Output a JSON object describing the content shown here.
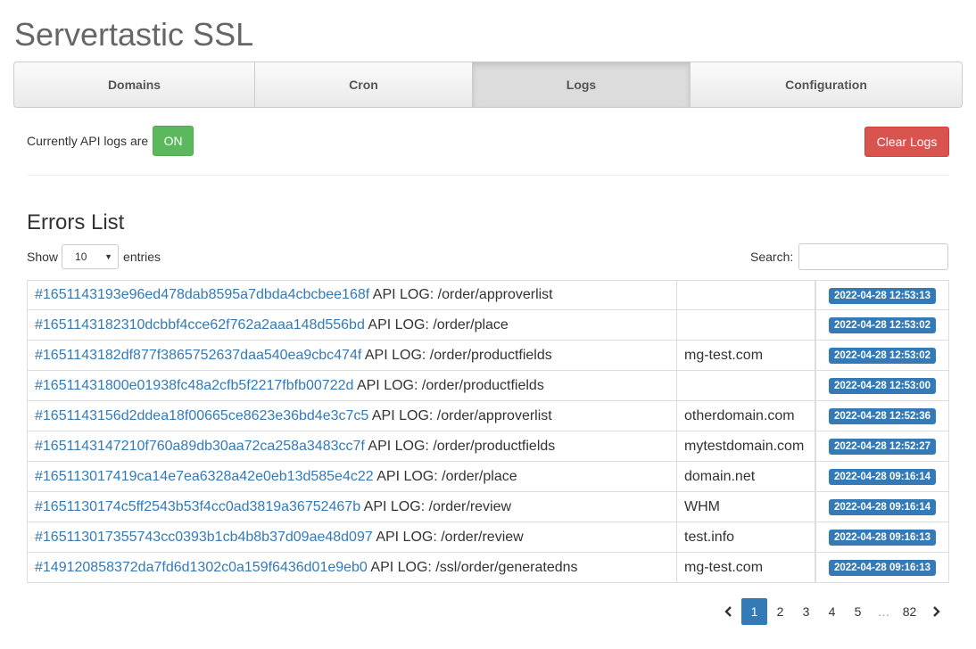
{
  "app": {
    "title": "Servertastic SSL"
  },
  "tabs": [
    {
      "label": "Domains",
      "active": false
    },
    {
      "label": "Cron",
      "active": false
    },
    {
      "label": "Logs",
      "active": true
    },
    {
      "label": "Configuration",
      "active": false
    }
  ],
  "api_logs": {
    "status_text": "Currently API logs are",
    "toggle_label": "ON",
    "toggle_color": "#5cb85c"
  },
  "clear_button": {
    "label": "Clear Logs",
    "color": "#d9534f"
  },
  "errors": {
    "title": "Errors List",
    "show_label": "Show",
    "entries_label": "entries",
    "page_size": "10",
    "search_label": "Search:",
    "search_value": "",
    "rows": [
      {
        "id": "#1651143193e96ed478dab8595a7dbda4cbcbee168f",
        "text": " API LOG: /order/approverlist",
        "domain": "",
        "date": "2022-04-28 12:53:13"
      },
      {
        "id": "#1651143182310dcbbf4cce62f762a2aaa148d556bd",
        "text": " API LOG: /order/place",
        "domain": "",
        "date": "2022-04-28 12:53:02"
      },
      {
        "id": "#1651143182df877f3865752637daa540ea9cbc474f",
        "text": " API LOG: /order/productfields",
        "domain": "mg-test.com",
        "date": "2022-04-28 12:53:02"
      },
      {
        "id": "#16511431800e01938fc48a2cfb5f2217fbfb00722d",
        "text": " API LOG: /order/productfields",
        "domain": "",
        "date": "2022-04-28 12:53:00"
      },
      {
        "id": "#1651143156d2ddea18f00665ce8623e36bd4e3c7c5",
        "text": " API LOG: /order/approverlist",
        "domain": "otherdomain.com",
        "date": "2022-04-28 12:52:36"
      },
      {
        "id": "#1651143147210f760a89db30aa72ca258a3483cc7f",
        "text": " API LOG: /order/productfields",
        "domain": "mytestdomain.com",
        "date": "2022-04-28 12:52:27"
      },
      {
        "id": "#165113017419ca14e7ea6328a42e0eb13d585e4c22",
        "text": " API LOG: /order/place",
        "domain": "domain.net",
        "date": "2022-04-28 09:16:14"
      },
      {
        "id": "#1651130174c5ff2543b53f4cc0ad3819a36752467b",
        "text": " API LOG: /order/review",
        "domain": "WHM",
        "date": "2022-04-28 09:16:14"
      },
      {
        "id": "#165113017355743cc0393b1cb4b8b37d09ae48d097",
        "text": " API LOG: /order/review",
        "domain": "test.info",
        "date": "2022-04-28 09:16:13"
      },
      {
        "id": "#149120858372da7fd6d1302c0a159f6436d01e9eb0",
        "text": " API LOG: /ssl/order/generatedns",
        "domain": "mg-test.com",
        "date": "2022-04-28 09:16:13"
      }
    ]
  },
  "pagination": {
    "prev_icon": "chevron-left-icon",
    "pages": [
      "1",
      "2",
      "3",
      "4",
      "5",
      "…",
      "82"
    ],
    "active_page": "1",
    "next_icon": "chevron-right-icon"
  },
  "colors": {
    "link": "#337ab7",
    "label": "#337ab7"
  }
}
